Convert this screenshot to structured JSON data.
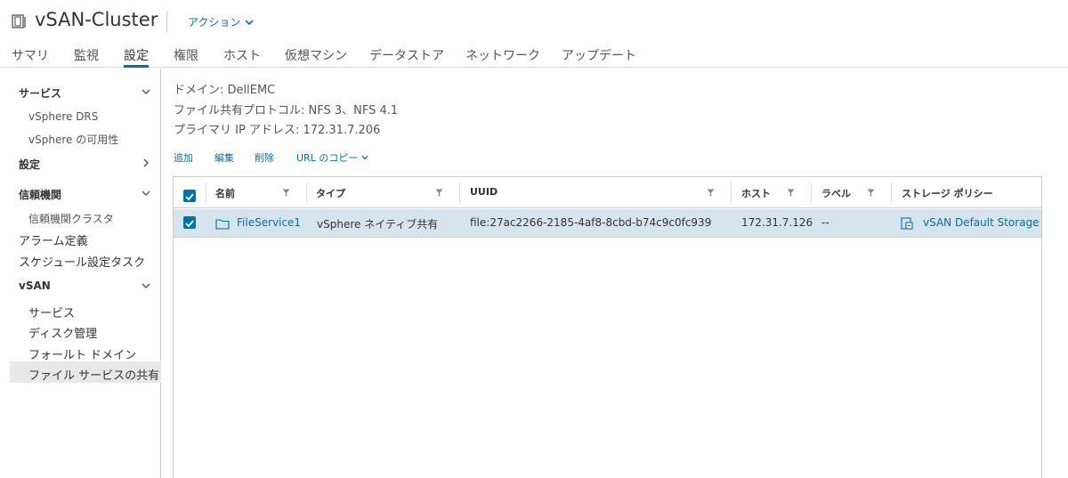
{
  "header": {
    "title": "vSAN-Cluster",
    "actions_label": "アクション"
  },
  "tabs": [
    {
      "label": "サマリ"
    },
    {
      "label": "監視"
    },
    {
      "label": "設定",
      "active": true
    },
    {
      "label": "権限"
    },
    {
      "label": "ホスト"
    },
    {
      "label": "仮想マシン"
    },
    {
      "label": "データストア"
    },
    {
      "label": "ネットワーク"
    },
    {
      "label": "アップデート"
    }
  ],
  "sidebar": {
    "services_section": "サービス",
    "vsphere_drs": "vSphere DRS",
    "vsphere_ha": "vSphere の可用性",
    "settings_section": "設定",
    "trust_section": "信頼機関",
    "trust_cluster": "信頼機関クラスタ",
    "alarm_definitions": "アラーム定義",
    "scheduled_tasks": "スケジュール設定タスク",
    "vsan_section": "vSAN",
    "vsan_services": "サービス",
    "disk_management": "ディスク管理",
    "fault_domains": "フォールト ドメイン",
    "file_shares": "ファイル サービスの共有"
  },
  "info": {
    "domain": "ドメイン: DellEMC",
    "protocols": "ファイル共有プロトコル: NFS 3、NFS 4.1",
    "primary_ip": "プライマリ IP アドレス: 172.31.7.206"
  },
  "toolbar": {
    "add": "追加",
    "edit": "編集",
    "delete": "削除",
    "copy_url": "URL のコピー"
  },
  "grid": {
    "columns": [
      "名前",
      "タイプ",
      "UUID",
      "ホスト",
      "ラベル",
      "ストレージ ポリシー"
    ],
    "rows": [
      {
        "name": "FileService1",
        "type": "vSphere ネイティブ共有",
        "uuid": "file:27ac2266-2185-4af8-8cbd-b74c9c0fc939",
        "host": "172.31.7.126",
        "label": "--",
        "policy": "vSAN Default Storage P",
        "selected": true
      }
    ]
  },
  "colors": {
    "accent": "#0072a3",
    "row_selected": "#d6e4ee",
    "sidebar_selected": "#e8e8e8"
  }
}
